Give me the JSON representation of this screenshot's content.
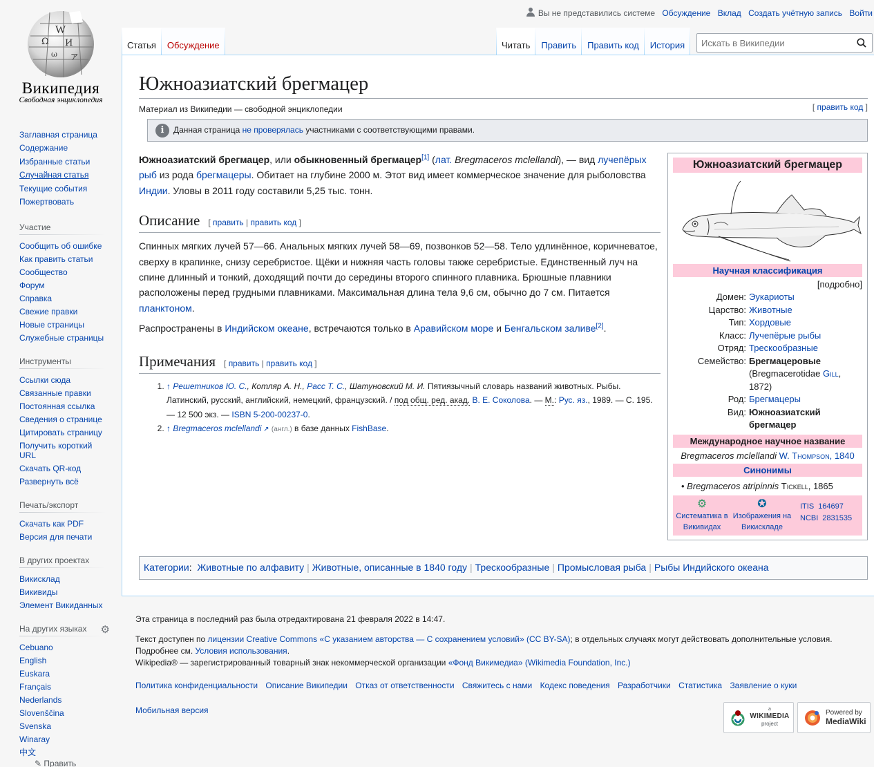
{
  "logo": {
    "wordmark": "Википедия",
    "tagline": "Свободная энциклопедия"
  },
  "personal": {
    "anon": "Вы не представились системе",
    "talk": "Обсуждение",
    "contribs": "Вклад",
    "create": "Создать учётную запись",
    "login": "Войти"
  },
  "tabs_left": {
    "article": "Статья",
    "talk": "Обсуждение"
  },
  "tabs_right": {
    "read": "Читать",
    "edit": "Править",
    "edit_source": "Править код",
    "history": "История"
  },
  "search": {
    "placeholder": "Искать в Википедии"
  },
  "sidebar": {
    "nav": [
      "Заглавная страница",
      "Содержание",
      "Избранные статьи",
      "Случайная статья",
      "Текущие события",
      "Пожертвовать"
    ],
    "participation": {
      "heading": "Участие",
      "items": [
        "Сообщить об ошибке",
        "Как править статьи",
        "Сообщество",
        "Форум",
        "Справка",
        "Свежие правки",
        "Новые страницы",
        "Служебные страницы"
      ]
    },
    "tools": {
      "heading": "Инструменты",
      "items": [
        "Ссылки сюда",
        "Связанные правки",
        "Постоянная ссылка",
        "Сведения о странице",
        "Цитировать страницу",
        "Получить короткий URL",
        "Скачать QR-код",
        "Развернуть всё"
      ]
    },
    "print": {
      "heading": "Печать/экспорт",
      "items": [
        "Скачать как PDF",
        "Версия для печати"
      ]
    },
    "projects": {
      "heading": "В других проектах",
      "items": [
        "Викисклад",
        "Викивиды",
        "Элемент Викиданных"
      ]
    },
    "langs": {
      "heading": "На других языках",
      "items": [
        "Cebuano",
        "English",
        "Euskara",
        "Français",
        "Nederlands",
        "Slovenščina",
        "Svenska",
        "Winaray",
        "中文"
      ],
      "edit_links": "Править ссылки"
    }
  },
  "page": {
    "title": "Южноазиатский брегмацер",
    "site_sub": "Материал из Википедии — свободной энциклопедии",
    "edit_top": "править код",
    "flagged_pre": "Данная страница ",
    "flagged_link": "не проверялась",
    "flagged_post": " участниками с соответствующими правами."
  },
  "intro": {
    "b1": "Южноазиатский брегмацер",
    "t1": ", или ",
    "b2": "обыкновенный брегмацер",
    "ref1": "[1]",
    "t2": " (",
    "lat": "лат.",
    "t3": " ",
    "latname": "Bregmaceros mclellandi",
    "t4": "), — вид ",
    "l1": "лучепёрых рыб",
    "t5": " из рода ",
    "l2": "брегмацеры",
    "t6": ". Обитает на глубине 2000 м. Этот вид имеет коммерческое значение для рыболовства ",
    "l3": "Индии",
    "t7": ". Уловы в 2011 году составили 5,25 тыс. тонн."
  },
  "sections": {
    "desc_title": "Описание",
    "edit": "править",
    "edit_code": "править код",
    "desc_text": "Спинных мягких лучей 57—66. Анальных мягких лучей 58—69, позвонков 52—58. Тело удлинённое, коричневатое, сверху в крапинке, снизу серебристое. Щёки и нижняя часть головы также серебристые. Единственный луч на спине длинный и тонкий, доходящий почти до середины второго спинного плавника. Брюшные плавники расположены перед грудными плавниками. Максимальная длина тела 9,6 см, обычно до 7 см. Питается ",
    "desc_link": "планктоном",
    "desc_end": ".",
    "dist_pre": "Распространены в ",
    "dist_l1": "Индийском океане",
    "dist_mid": ", встречаются только в ",
    "dist_l2": "Аравийском море",
    "dist_and": " и ",
    "dist_l3": "Бенгальском заливе",
    "dist_ref": "[2]",
    "dist_end": ".",
    "notes_title": "Примечания"
  },
  "refs": {
    "r1": {
      "arrow": "↑",
      "a1": "Решетников Ю. С.",
      "a2": ", Котляр А. Н., ",
      "a3": "Расс Т. С.",
      "a4": ", Шатуновский М. И.",
      "text": " Пятиязычный словарь названий животных. Рыбы. Латинский, русский, английский, немецкий, французский. / ",
      "ed": "под общ. ред. акад.",
      "sp": " ",
      "editor": "В. Е. Соколова",
      "t2": ". — ",
      "city": "М.",
      "t3": ": ",
      "pub": "Рус. яз.",
      "t4": ", 1989. — С. 195. — 12 500 экз. — ",
      "isbn": "ISBN 5-200-00237-0",
      "t5": "."
    },
    "r2": {
      "arrow": "↑",
      "link": "Bregmaceros mclellandi",
      "lang": "(англ.)",
      "text": " в базе данных ",
      "db": "FishBase",
      "end": "."
    }
  },
  "infobox": {
    "title": "Южноазиатский брегмацер",
    "classification": "Научная классификация",
    "more": "[подробно]",
    "rows": [
      {
        "k": "Домен:",
        "v": "Эукариоты",
        "link": true
      },
      {
        "k": "Царство:",
        "v": "Животные",
        "link": true
      },
      {
        "k": "Тип:",
        "v": "Хордовые",
        "link": true
      },
      {
        "k": "Класс:",
        "v": "Лучепёрые рыбы",
        "link": true
      },
      {
        "k": "Отряд:",
        "v": "Трескообразные",
        "link": true
      }
    ],
    "family_k": "Семейство:",
    "family_v": "Брегмацеровые",
    "family_lat": "(Bregmacerotidae ",
    "family_auth": "Gill",
    "family_yr": ", 1872)",
    "genus_k": "Род:",
    "genus_v": "Брегмацеры",
    "species_k": "Вид:",
    "species_v": "Южноазиатский брегмацер",
    "intl": "Международное научное название",
    "binomial": "Bregmaceros mclellandi",
    "binom_auth": "W. Thompson, 1840",
    "synonyms": "Синонимы",
    "syn1": "Bregmaceros atripinnis",
    "syn1_auth": "Tickell",
    "syn1_yr": ", 1865",
    "wikispecies": "Систематика в Викивидах",
    "commons": "Изображения на Викискладе",
    "itis_label": "ITIS",
    "itis": "164697",
    "ncbi_label": "NCBI",
    "ncbi": "2831535"
  },
  "categories": {
    "label": "Категории",
    "items": [
      "Животные по алфавиту",
      "Животные, описанные в 1840 году",
      "Трескообразные",
      "Промысловая рыба",
      "Рыбы Индийского океана"
    ]
  },
  "footer": {
    "lastmod": "Эта страница в последний раз была отредактирована 21 февраля 2022 в 14:47.",
    "lic_pre": "Текст доступен по ",
    "lic_link": "лицензии Creative Commons «С указанием авторства — С сохранением условий» (CC BY-SA)",
    "lic_post": "; в отдельных случаях могут действовать дополнительные условия.",
    "terms_pre": "Подробнее см. ",
    "terms_link": "Условия использования",
    "terms_end": ".",
    "tm_pre": "Wikipedia® — зарегистрированный товарный знак некоммерческой организации ",
    "tm_link": "«Фонд Викимедиа» (Wikimedia Foundation, Inc.)",
    "places": [
      "Политика конфиденциальности",
      "Описание Википедии",
      "Отказ от ответственности",
      "Свяжитесь с нами",
      "Кодекс поведения",
      "Разработчики",
      "Статистика",
      "Заявление о куки"
    ],
    "mobile": "Мобильная версия",
    "wm_badge_small": "a",
    "wm_badge": "WIKIMEDIA",
    "wm_badge_sub": "project",
    "mw_badge_top": "Powered by",
    "mw_badge": "MediaWiki"
  }
}
